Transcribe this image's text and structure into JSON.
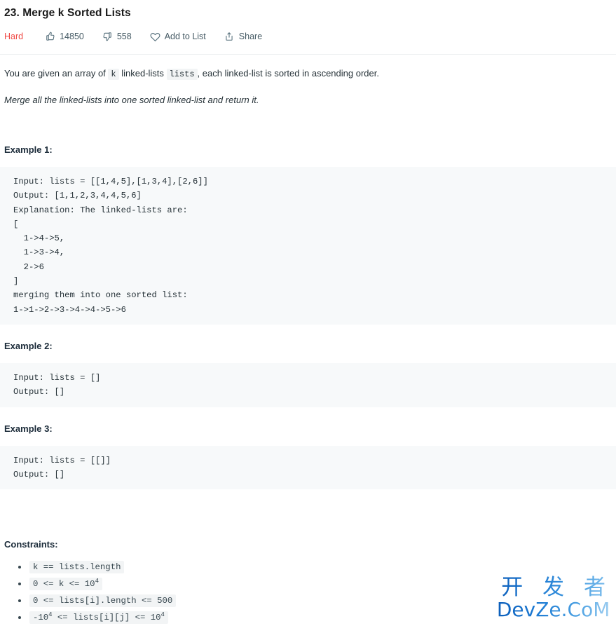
{
  "problem": {
    "title": "23. Merge k Sorted Lists",
    "difficulty": "Hard",
    "likes": "14850",
    "dislikes": "558",
    "add_to_list_label": "Add to List",
    "share_label": "Share"
  },
  "description": {
    "intro_part1": "You are given an array of ",
    "intro_code_k": "k",
    "intro_part2": " linked-lists ",
    "intro_code_lists": "lists",
    "intro_part3": ", each linked-list is sorted in ascending order.",
    "goal": "Merge all the linked-lists into one sorted linked-list and return it."
  },
  "examples": [
    {
      "heading": "Example 1:",
      "code": "Input: lists = [[1,4,5],[1,3,4],[2,6]]\nOutput: [1,1,2,3,4,4,5,6]\nExplanation: The linked-lists are:\n[\n  1->4->5,\n  1->3->4,\n  2->6\n]\nmerging them into one sorted list:\n1->1->2->3->4->4->5->6"
    },
    {
      "heading": "Example 2:",
      "code": "Input: lists = []\nOutput: []"
    },
    {
      "heading": "Example 3:",
      "code": "Input: lists = [[]]\nOutput: []"
    }
  ],
  "constraints": {
    "heading": "Constraints:",
    "items": [
      {
        "text": "k == lists.length",
        "sup": null
      },
      {
        "pre": "0 <= k <= 10",
        "sup": "4",
        "post": ""
      },
      {
        "text": "0 <= lists[i].length <= 500",
        "sup": null
      },
      {
        "pre": "-10",
        "sup": "4",
        "post": " <= lists[i][j] <= 10",
        "sup2": "4"
      }
    ]
  },
  "watermark": {
    "chinese": "开 发 者",
    "english": "DevZe.CoM",
    "color": "#1a78d2"
  }
}
